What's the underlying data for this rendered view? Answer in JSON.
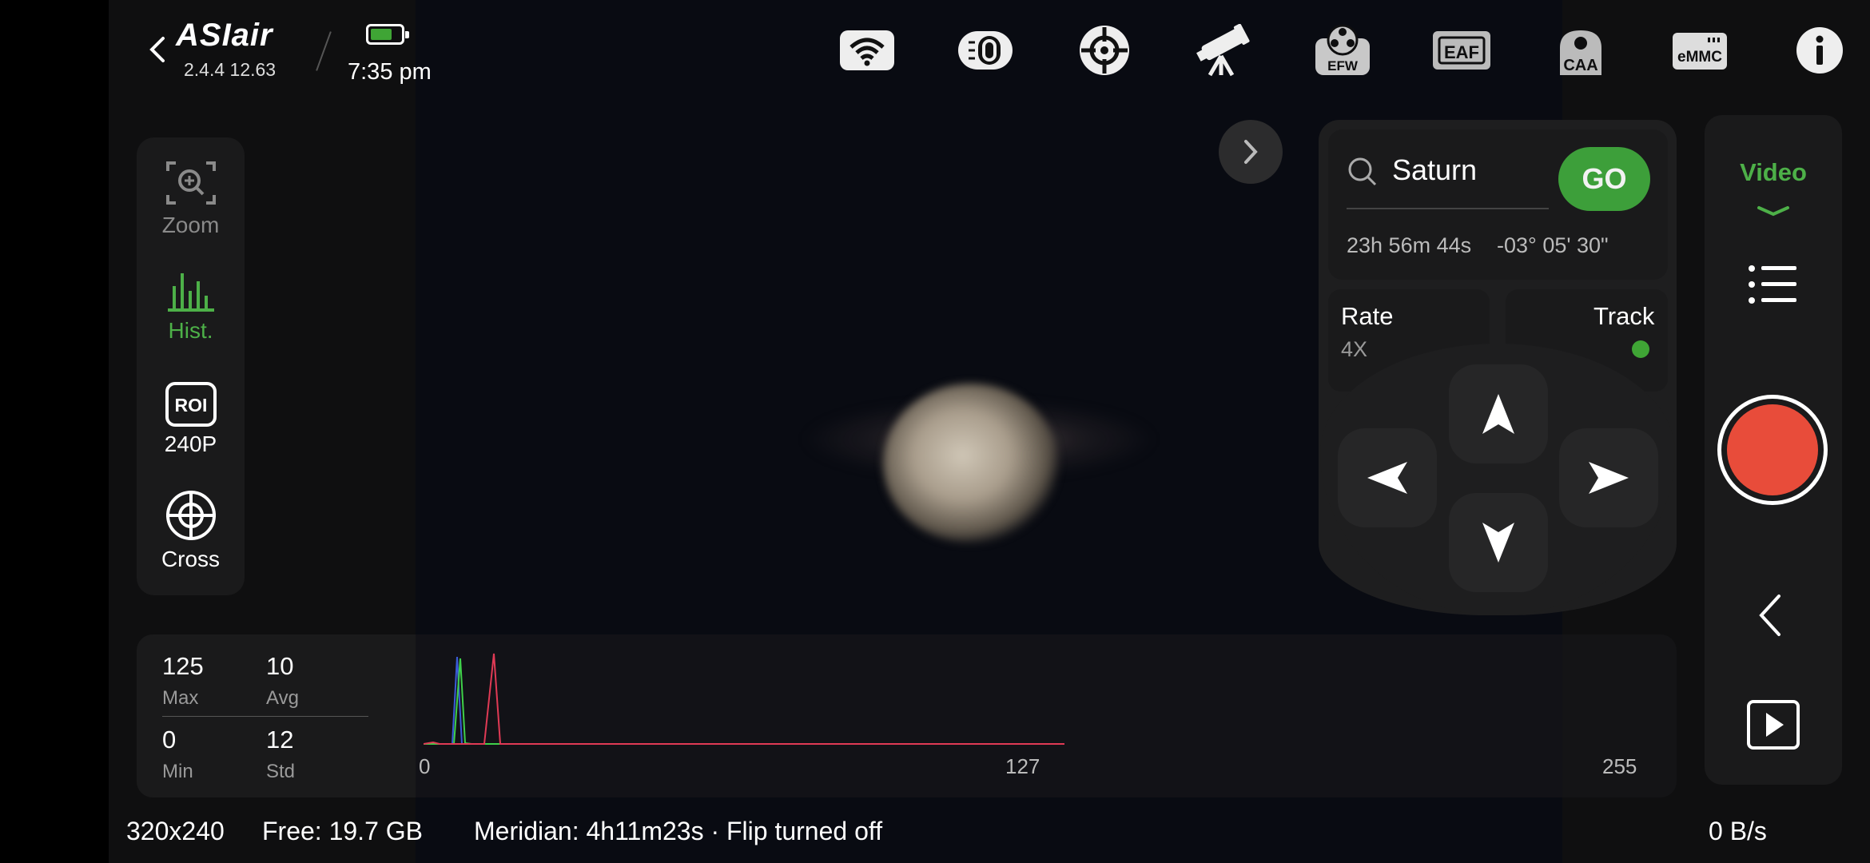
{
  "header": {
    "brand": "ASIair",
    "version": "2.4.4 12.63",
    "time": "7:35 pm",
    "battery_color": "#3fa535",
    "status_icons": [
      "wifi-icon",
      "camera-icon",
      "guide-scope-icon",
      "telescope-icon",
      "efw-icon",
      "eaf-icon",
      "caa-icon",
      "emmc-icon",
      "info-icon"
    ],
    "efw_label": "EFW",
    "eaf_label": "EAF",
    "caa_label": "CAA",
    "emmc_label": "eMMC"
  },
  "tools": {
    "zoom_label": "Zoom",
    "hist_label": "Hist.",
    "roi_badge": "ROI",
    "roi_value": "240P",
    "cross_label": "Cross"
  },
  "stats": {
    "max_value": "125",
    "max_label": "Max",
    "avg_value": "10",
    "avg_label": "Avg",
    "min_value": "0",
    "min_label": "Min",
    "std_value": "12",
    "std_label": "Std"
  },
  "histogram": {
    "axis_start": "0",
    "axis_mid": "127",
    "axis_end": "255",
    "colors": {
      "blue": "#3a5bd8",
      "green": "#3fd04a",
      "red": "#e03a55"
    }
  },
  "goto": {
    "target": "Saturn",
    "go_label": "GO",
    "ra": "23h 56m 44s",
    "dec": "-03° 05' 30\"",
    "go_color": "#3d9f3a"
  },
  "mount": {
    "rate_label": "Rate",
    "rate_value": "4X",
    "track_label": "Track",
    "track_color": "#3fa535"
  },
  "side": {
    "mode_label": "Video",
    "accent": "#4db048",
    "record_color": "#e84c3a"
  },
  "status_bar": {
    "resolution": "320x240",
    "free": "Free: 19.7 GB",
    "meridian": "Meridian: 4h11m23s · Flip turned off",
    "rate": "0 B/s"
  }
}
